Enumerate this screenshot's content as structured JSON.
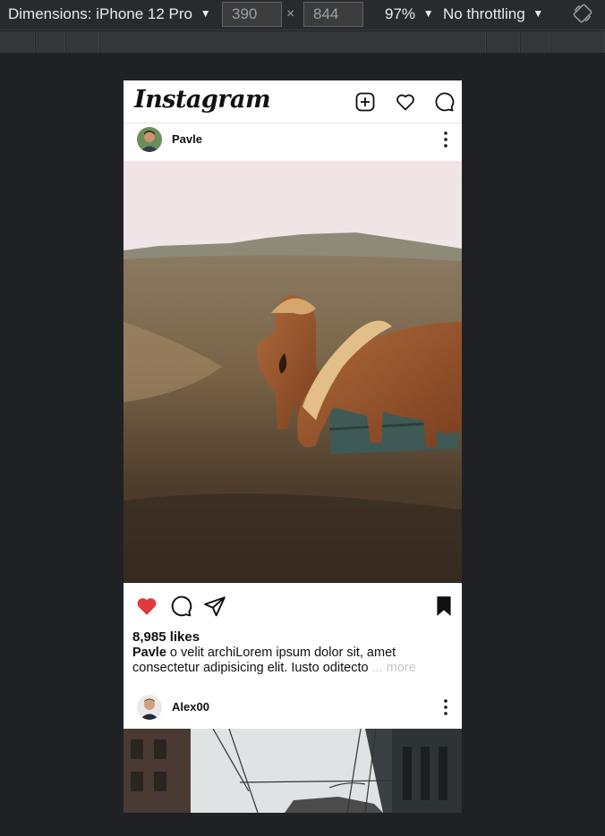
{
  "devtools": {
    "device_label": "Dimensions: iPhone 12 Pro",
    "width_value": "390",
    "height_value": "844",
    "times_sign": "×",
    "zoom": "97%",
    "throttling": "No throttling",
    "caret": "▼"
  },
  "app": {
    "logo": "Instagram"
  },
  "posts": [
    {
      "username": "Pavle",
      "likes": "8,985 likes",
      "caption_user": "Pavle",
      "caption_text": " o velit archiLorem ipsum dolor sit, amet consectetur adipisicing elit. Iusto oditecto",
      "more": " ... more",
      "liked": true,
      "saved": true
    },
    {
      "username": "Alex00"
    }
  ],
  "colors": {
    "like": "#e0393e",
    "background": "#202124"
  }
}
